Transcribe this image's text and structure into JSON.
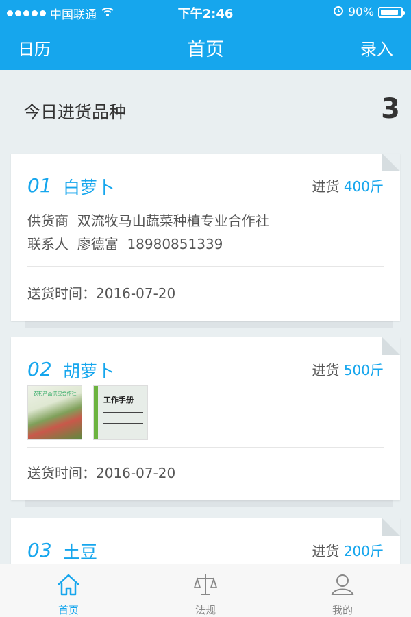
{
  "status_bar": {
    "carrier": "中国联通",
    "time": "下午2:46",
    "battery_percent": "90%",
    "battery_level": 0.9,
    "signal_dots": 5,
    "wifi_icon": "wifi-icon",
    "alarm_icon": "alarm-icon"
  },
  "nav": {
    "left": "日历",
    "title": "首页",
    "right": "录入"
  },
  "summary": {
    "label": "今日进货品种",
    "count": "3"
  },
  "labels": {
    "qty_prefix": "进货",
    "supplier": "供货商",
    "contact": "联系人",
    "delivery_time": "送货时间："
  },
  "items": [
    {
      "no": "01",
      "name": "白萝卜",
      "qty": "400斤",
      "supplier": "双流牧马山蔬菜种植专业合作社",
      "contact_name": "廖德富",
      "contact_phone": "18980851339",
      "delivery_date": "2016-07-20"
    },
    {
      "no": "02",
      "name": "胡萝卜",
      "qty": "500斤",
      "thumb1_title": "农村产品供应合作社",
      "thumb2_title": "工作手册",
      "delivery_date": "2016-07-20"
    },
    {
      "no": "03",
      "name": "土豆",
      "qty": "200斤"
    }
  ],
  "tabs": [
    {
      "label": "首页",
      "icon": "home-icon",
      "active": true
    },
    {
      "label": "法规",
      "icon": "scale-icon",
      "active": false
    },
    {
      "label": "我的",
      "icon": "user-icon",
      "active": false
    }
  ],
  "colors": {
    "accent": "#16a6ed",
    "background": "#e9eff1"
  }
}
